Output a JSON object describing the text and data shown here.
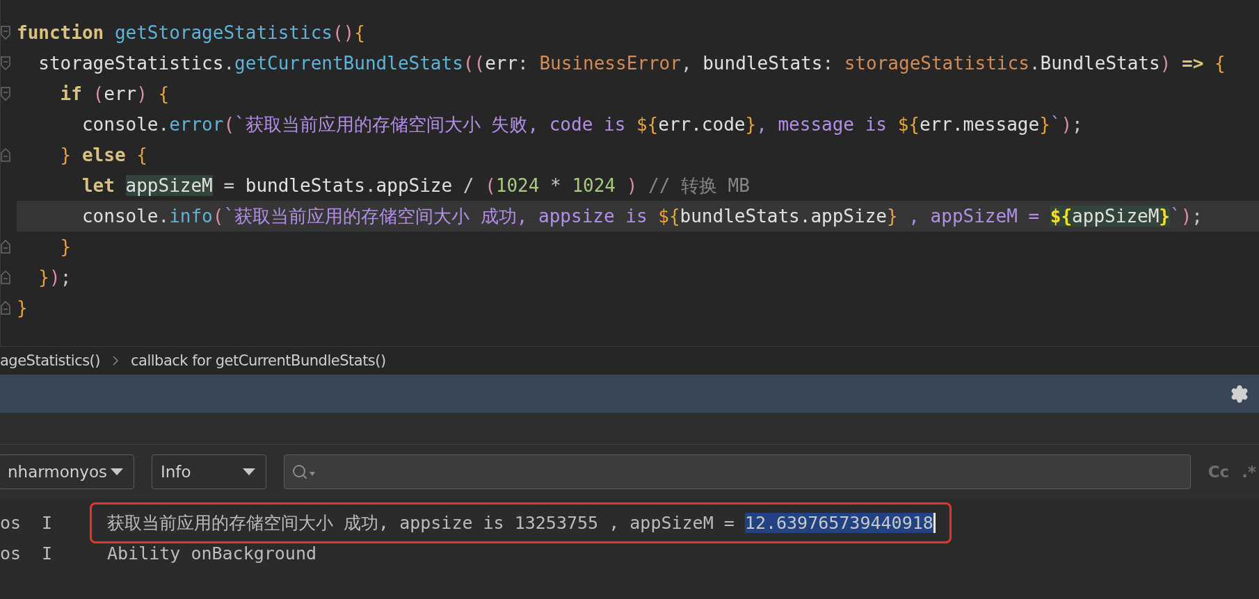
{
  "editor": {
    "lines": [
      {
        "fold_start": true,
        "fold_end": false,
        "current": false,
        "tokens": [
          {
            "text": "function",
            "kind": "kw"
          },
          {
            "text": " getStorageStatistics",
            "kind": "fn"
          },
          {
            "text": "()",
            "kind": "paren"
          },
          {
            "text": "{",
            "kind": "brace"
          }
        ]
      },
      {
        "fold_start": true,
        "fold_end": false,
        "current": false,
        "tokens": [
          {
            "text": "  storageStatistics",
            "kind": "id"
          },
          {
            "text": ".",
            "kind": "op"
          },
          {
            "text": "getCurrentBundleStats",
            "kind": "fn"
          },
          {
            "text": "((",
            "kind": "paren"
          },
          {
            "text": "err",
            "kind": "id"
          },
          {
            "text": ": ",
            "kind": "op"
          },
          {
            "text": "BusinessError",
            "kind": "type"
          },
          {
            "text": ", ",
            "kind": "op"
          },
          {
            "text": "bundleStats",
            "kind": "id"
          },
          {
            "text": ": ",
            "kind": "op"
          },
          {
            "text": "storageStatistics",
            "kind": "type"
          },
          {
            "text": ".",
            "kind": "op"
          },
          {
            "text": "BundleStats",
            "kind": "id"
          },
          {
            "text": ")",
            "kind": "paren"
          },
          {
            "text": " => ",
            "kind": "kw"
          },
          {
            "text": "{",
            "kind": "brace"
          }
        ]
      },
      {
        "fold_start": true,
        "fold_end": false,
        "current": false,
        "tokens": [
          {
            "text": "    if",
            "kind": "kw"
          },
          {
            "text": " (",
            "kind": "paren"
          },
          {
            "text": "err",
            "kind": "id"
          },
          {
            "text": ")",
            "kind": "paren"
          },
          {
            "text": " {",
            "kind": "brace"
          }
        ]
      },
      {
        "current": false,
        "tokens": [
          {
            "text": "      console",
            "kind": "id"
          },
          {
            "text": ".",
            "kind": "op"
          },
          {
            "text": "error",
            "kind": "fn"
          },
          {
            "text": "(",
            "kind": "paren"
          },
          {
            "text": "`获取当前应用的存储空间大小 失败, code is ",
            "kind": "str"
          },
          {
            "text": "${",
            "kind": "interp"
          },
          {
            "text": "err.code",
            "kind": "id"
          },
          {
            "text": "}",
            "kind": "interp"
          },
          {
            "text": ", message is ",
            "kind": "str"
          },
          {
            "text": "${",
            "kind": "interp"
          },
          {
            "text": "err.message",
            "kind": "id"
          },
          {
            "text": "}",
            "kind": "interp"
          },
          {
            "text": "`",
            "kind": "str"
          },
          {
            "text": ")",
            "kind": "paren"
          },
          {
            "text": ";",
            "kind": "op"
          }
        ]
      },
      {
        "fold_start": false,
        "fold_end": true,
        "current": false,
        "tokens": [
          {
            "text": "    }",
            "kind": "brace"
          },
          {
            "text": " else",
            "kind": "kw"
          },
          {
            "text": " {",
            "kind": "brace"
          }
        ]
      },
      {
        "current": false,
        "tokens": [
          {
            "text": "      let ",
            "kind": "kw"
          },
          {
            "text": "appSizeM",
            "kind": "id",
            "highlight": true
          },
          {
            "text": " = ",
            "kind": "op"
          },
          {
            "text": "bundleStats",
            "kind": "id"
          },
          {
            "text": ".",
            "kind": "op"
          },
          {
            "text": "appSize",
            "kind": "id"
          },
          {
            "text": " / ",
            "kind": "op"
          },
          {
            "text": "(",
            "kind": "paren"
          },
          {
            "text": "1024",
            "kind": "num"
          },
          {
            "text": " * ",
            "kind": "op"
          },
          {
            "text": "1024",
            "kind": "num"
          },
          {
            "text": " )",
            "kind": "paren"
          },
          {
            "text": " // 转换 MB",
            "kind": "cmt"
          }
        ]
      },
      {
        "current": true,
        "tokens": [
          {
            "text": "      console",
            "kind": "id"
          },
          {
            "text": ".",
            "kind": "op"
          },
          {
            "text": "info",
            "kind": "fn"
          },
          {
            "text": "(",
            "kind": "paren"
          },
          {
            "text": "`获取当前应用的存储空间大小 成功, appsize is ",
            "kind": "str"
          },
          {
            "text": "${",
            "kind": "interp"
          },
          {
            "text": "bundleStats.appSize",
            "kind": "id"
          },
          {
            "text": "}",
            "kind": "interp"
          },
          {
            "text": " , appSizeM = ",
            "kind": "str"
          },
          {
            "text": "${",
            "kind": "match",
            "highlight": true
          },
          {
            "text": "appSizeM",
            "kind": "id",
            "highlight": true
          },
          {
            "text": "}",
            "kind": "match",
            "highlight": true
          },
          {
            "text": "`",
            "kind": "str"
          },
          {
            "text": ")",
            "kind": "paren"
          },
          {
            "text": ";",
            "kind": "op"
          }
        ]
      },
      {
        "fold_start": false,
        "fold_end": true,
        "current": false,
        "tokens": [
          {
            "text": "    }",
            "kind": "brace"
          }
        ]
      },
      {
        "fold_start": false,
        "fold_end": true,
        "current": false,
        "tokens": [
          {
            "text": "  }",
            "kind": "brace"
          },
          {
            "text": ")",
            "kind": "paren"
          },
          {
            "text": ";",
            "kind": "op"
          }
        ]
      },
      {
        "fold_start": false,
        "fold_end": true,
        "current": false,
        "tokens": [
          {
            "text": "}",
            "kind": "brace"
          }
        ]
      }
    ]
  },
  "breadcrumbs": [
    "ageStatistics()",
    "callback for getCurrentBundleStats()"
  ],
  "log_panel": {
    "device_dropdown": "nharmonyos",
    "level_dropdown": "Info",
    "toggles": [
      "Cc",
      ".*"
    ],
    "rows": [
      {
        "process": "os",
        "level": "I",
        "message": "获取当前应用的存储空间大小 成功, appsize is 13253755 , appSizeM = ",
        "selection": "12.639765739440918",
        "annotated": true
      },
      {
        "process": "os",
        "level": "I",
        "message": "Ability onBackground",
        "annotated": false
      }
    ]
  }
}
